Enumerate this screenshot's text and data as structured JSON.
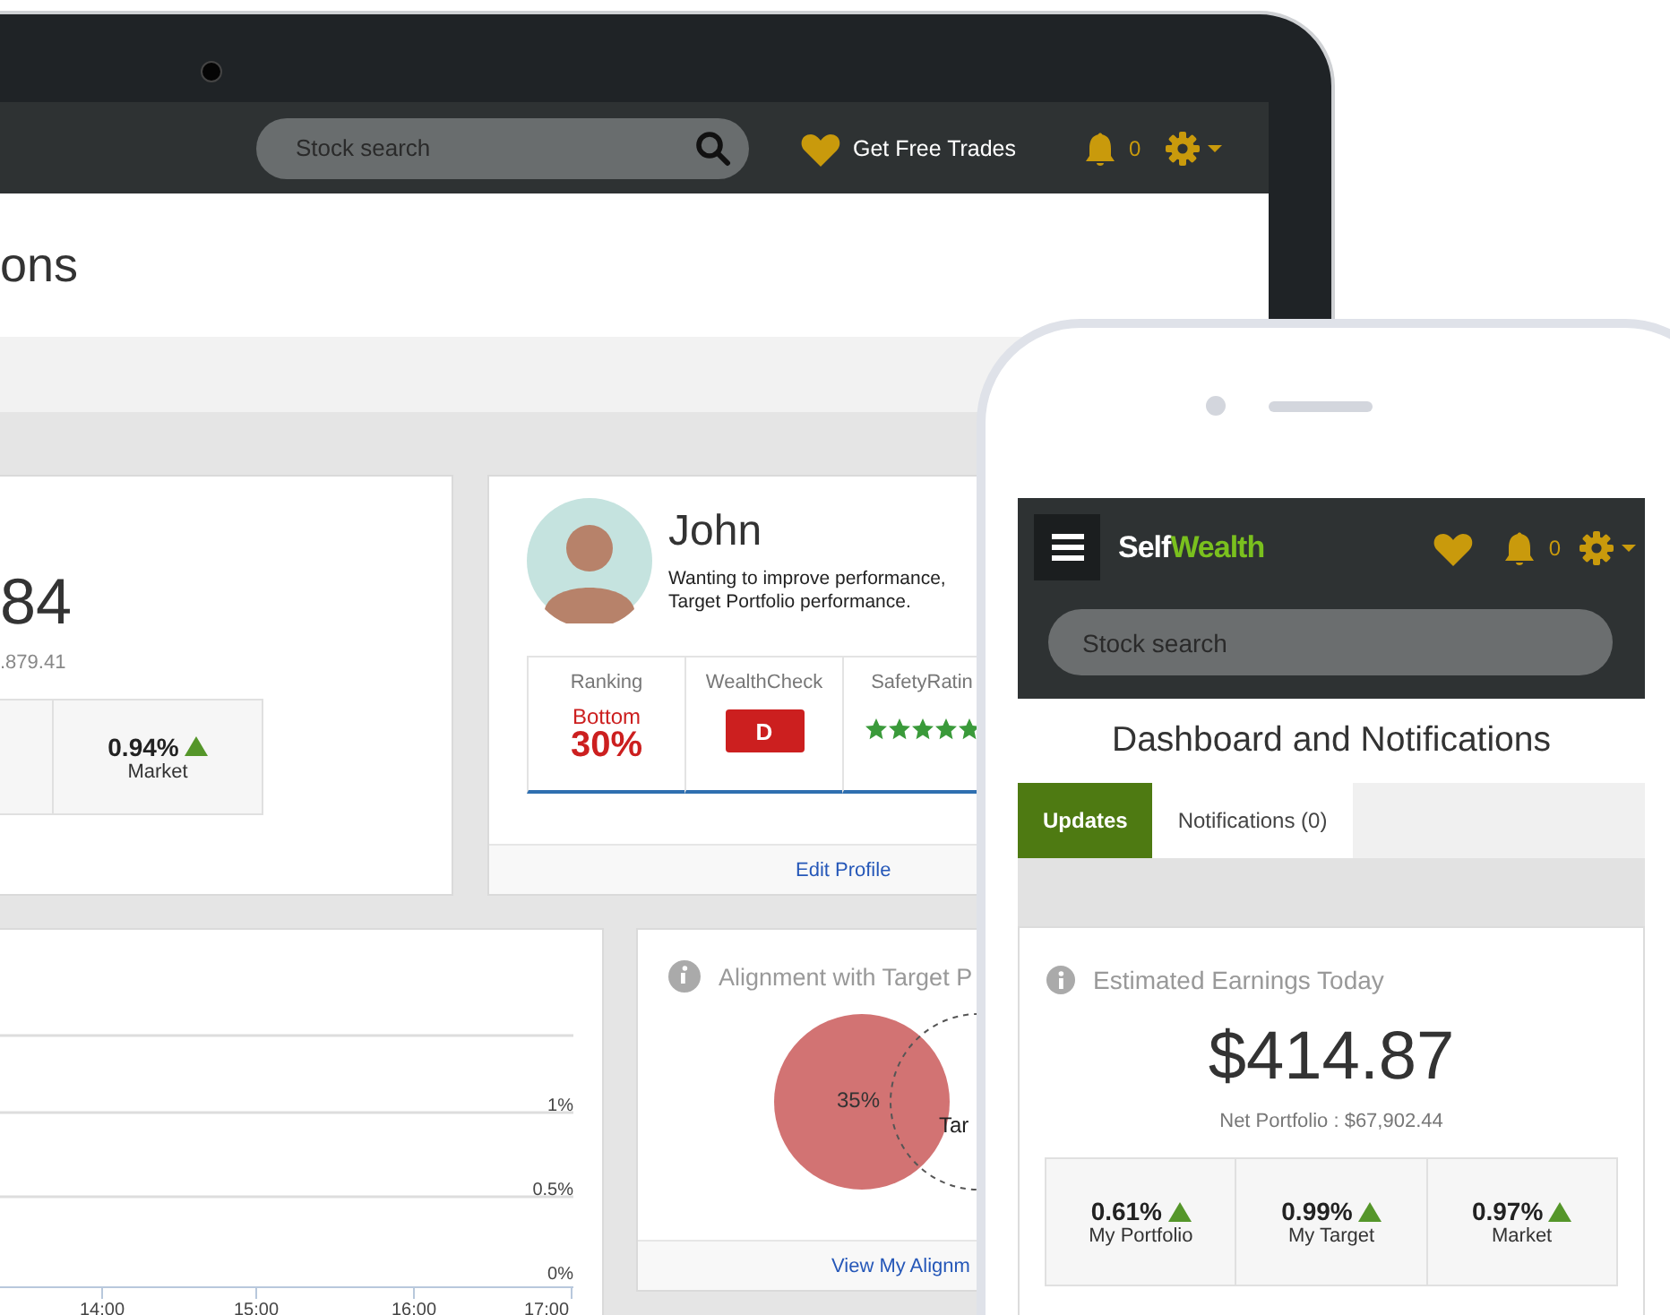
{
  "laptop": {
    "navbar": {
      "search": {
        "placeholder": "Stock search"
      },
      "promo": "Get Free Trades",
      "notifications_count": "0"
    },
    "page_title": "ons",
    "earnings_card": {
      "amount": "84",
      "net": ".879.41",
      "stats": [
        {
          "value": "0.94%",
          "label": "Market",
          "rising": true
        }
      ]
    },
    "profile_card": {
      "name": "John",
      "bio": [
        "Wanting to improve performance,",
        "Target Portfolio performance."
      ],
      "stats": [
        {
          "kind": "ranking",
          "label": "Ranking",
          "qualifier": "Bottom",
          "value": "30%"
        },
        {
          "kind": "grade",
          "label": "WealthCheck",
          "value": "D"
        },
        {
          "kind": "stars",
          "label": "SafetyRatin",
          "stars": 5
        }
      ],
      "link": "Edit Profile"
    },
    "chart_card": {
      "y_labels": [
        "1%",
        "0.5%",
        "0%"
      ],
      "x_labels": [
        "14:00",
        "15:00",
        "16:00",
        "17:00"
      ]
    },
    "alignment_card": {
      "title": "Alignment with Target P",
      "portfolio_share": "35%",
      "target_label": "Tar",
      "link": "View My Alignm"
    }
  },
  "phone": {
    "navbar": {
      "logo": [
        "Self",
        "Wealth"
      ],
      "notifications_count": "0",
      "search": {
        "placeholder": "Stock search"
      }
    },
    "title": "Dashboard and Notifications",
    "tabs": [
      {
        "label": "Updates",
        "selected": true
      },
      {
        "label": "Notifications (0)",
        "selected": false
      }
    ],
    "earnings_card": {
      "title": "Estimated Earnings Today",
      "amount": "$414.87",
      "net": "Net Portfolio : $67,902.44",
      "stats": [
        {
          "value": "0.61%",
          "label": "My Portfolio",
          "rising": true
        },
        {
          "value": "0.99%",
          "label": "My Target",
          "rising": true
        },
        {
          "value": "0.97%",
          "label": "Market",
          "rising": true
        }
      ]
    }
  }
}
